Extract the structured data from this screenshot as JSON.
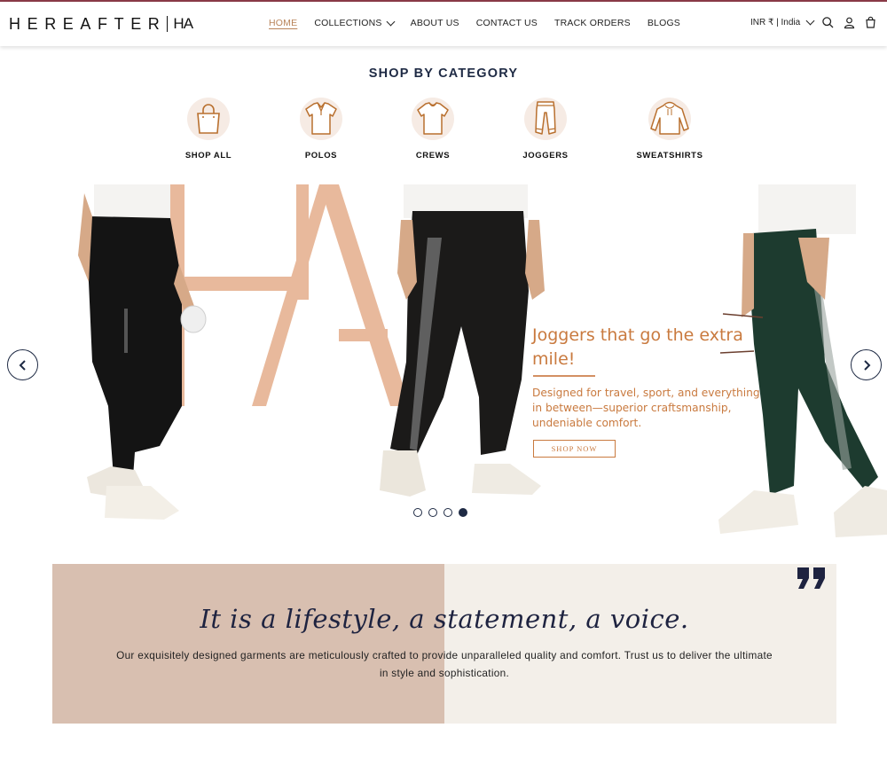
{
  "header": {
    "logo_text": "HEREAFTER",
    "logo_mark": "HA",
    "nav": [
      {
        "label": "HOME",
        "active": true
      },
      {
        "label": "COLLECTIONS",
        "dropdown": true
      },
      {
        "label": "ABOUT US"
      },
      {
        "label": "CONTACT US"
      },
      {
        "label": "TRACK ORDERS"
      },
      {
        "label": "BLOGS"
      }
    ],
    "locale": "INR ₹ | India",
    "icons": [
      "search-icon",
      "account-icon",
      "cart-icon"
    ]
  },
  "categories": {
    "title": "SHOP BY CATEGORY",
    "items": [
      {
        "label": "SHOP ALL",
        "icon": "shopping-bag-icon"
      },
      {
        "label": "POLOS",
        "icon": "polo-shirt-icon"
      },
      {
        "label": "CREWS",
        "icon": "crew-tshirt-icon"
      },
      {
        "label": "JOGGERS",
        "icon": "joggers-icon"
      },
      {
        "label": "SWEATSHIRTS",
        "icon": "sweatshirt-icon"
      }
    ]
  },
  "hero": {
    "headline": "Joggers that go the extra mile!",
    "subtext": "Designed for travel, sport, and everything in between—superior craftsmanship, undeniable comfort.",
    "cta": "SHOP NOW",
    "slide_count": 4,
    "active_slide": 4,
    "colors": {
      "accent": "#c97a3f",
      "monogram": "#e8b99c",
      "navy": "#1e2a44"
    }
  },
  "quote": {
    "title": "It is a lifestyle, a statement, a voice.",
    "body": "Our exquisitely designed garments are meticulously crafted to provide unparalleled quality and comfort. Trust us to deliver the ultimate in style and sophistication."
  }
}
